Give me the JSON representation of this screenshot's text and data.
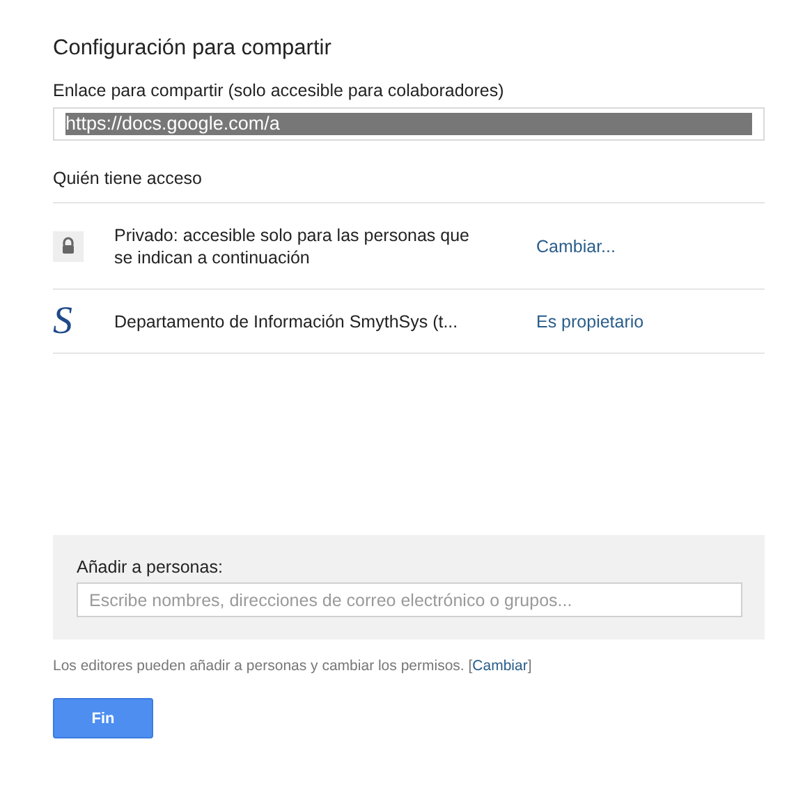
{
  "title": "Configuración para compartir",
  "link": {
    "label": "Enlace para compartir (solo accesible para colaboradores)",
    "value": "https://docs.google.com/a",
    "selected": true
  },
  "access": {
    "heading": "Quién tiene acceso",
    "rows": [
      {
        "kind": "lock",
        "text": "Privado: accesible solo para las personas que se indican a continuación",
        "action": "Cambiar..."
      },
      {
        "kind": "owner",
        "icon_letter": "S",
        "text": "Departamento de Información SmythSys (t...",
        "action": "Es propietario"
      }
    ]
  },
  "add": {
    "label": "Añadir a personas:",
    "placeholder": "Escribe nombres, direcciones de correo electrónico o grupos..."
  },
  "note": {
    "text": "Los editores pueden añadir a personas y cambiar los permisos.",
    "open": "[",
    "link": "Cambiar",
    "close": "]"
  },
  "buttons": [
    "Fin"
  ]
}
